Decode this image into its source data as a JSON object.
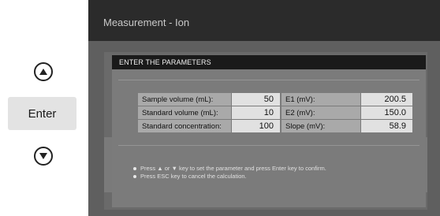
{
  "keypad": {
    "up_icon": "up-triangle-icon",
    "enter_label": "Enter",
    "down_icon": "down-triangle-icon"
  },
  "screen": {
    "title": "Measurement - Ion"
  },
  "dialog": {
    "title": "ENTER THE PARAMETERS",
    "rows": [
      {
        "label": "Sample volume (mL):",
        "value": "50",
        "label2": "E1 (mV):",
        "value2": "200.5"
      },
      {
        "label": "Standard volume (mL):",
        "value": "10",
        "label2": "E2 (mV):",
        "value2": "150.0"
      },
      {
        "label": "Standard concentration:",
        "value": "100",
        "label2": "Slope (mV):",
        "value2": "58.9"
      }
    ],
    "notes": [
      "Press ▲ or ▼ key to set the parameter and press Enter key to confirm.",
      "Press ESC key to cancel the calculation."
    ]
  },
  "colors": {
    "screen_bg": "#5f5f5f",
    "titlebar_bg": "#2b2b2b",
    "dialog_header_bg": "#1a1a1a",
    "label_cell_bg": "#a9a9a9",
    "value_cell_bg": "#e1e1e1",
    "enter_button_bg": "#e3e3e3"
  }
}
